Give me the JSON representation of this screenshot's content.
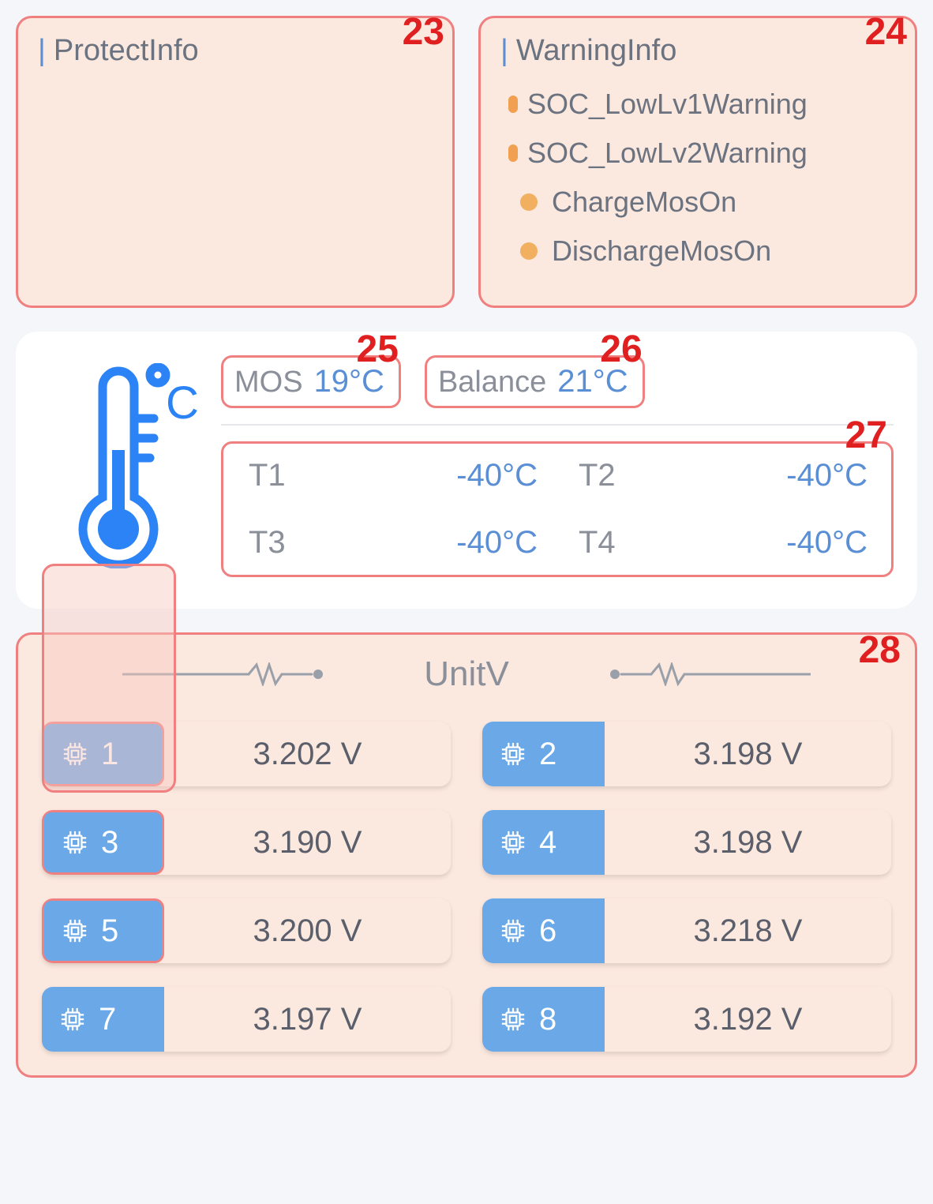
{
  "protect": {
    "title": "ProtectInfo",
    "badge": "23"
  },
  "warning": {
    "title": "WarningInfo",
    "badge": "24",
    "items": [
      {
        "label": "SOC_LowLv1Warning",
        "bullet": "small"
      },
      {
        "label": "SOC_LowLv2Warning",
        "bullet": "small"
      },
      {
        "label": "ChargeMosOn",
        "bullet": "round"
      },
      {
        "label": "DischargeMosOn",
        "bullet": "round"
      }
    ]
  },
  "temps": {
    "mos": {
      "label": "MOS",
      "value": "19°C",
      "badge": "25"
    },
    "balance": {
      "label": "Balance",
      "value": "21°C",
      "badge": "26"
    },
    "grid_badge": "27",
    "sensors": [
      {
        "label": "T1",
        "value": "-40°C"
      },
      {
        "label": "T2",
        "value": "-40°C"
      },
      {
        "label": "T3",
        "value": "-40°C"
      },
      {
        "label": "T4",
        "value": "-40°C"
      }
    ]
  },
  "unitv": {
    "title": "UnitV",
    "badge": "28",
    "cells": [
      {
        "num": "1",
        "value": "3.202 V"
      },
      {
        "num": "2",
        "value": "3.198 V"
      },
      {
        "num": "3",
        "value": "3.190 V"
      },
      {
        "num": "4",
        "value": "3.198 V"
      },
      {
        "num": "5",
        "value": "3.200 V"
      },
      {
        "num": "6",
        "value": "3.218 V"
      },
      {
        "num": "7",
        "value": "3.197 V"
      },
      {
        "num": "8",
        "value": "3.192 V"
      }
    ]
  }
}
